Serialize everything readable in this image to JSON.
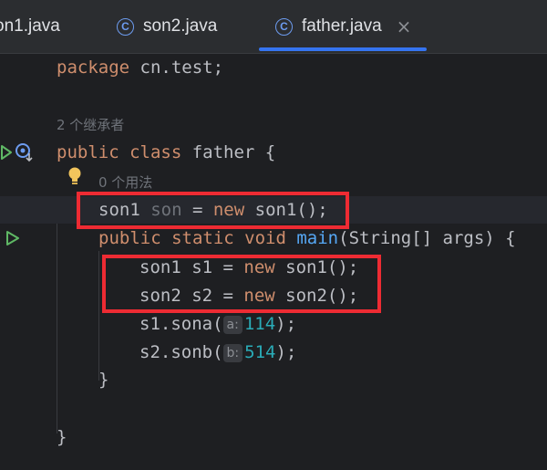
{
  "tabs": [
    {
      "label": "on1.java"
    },
    {
      "label": "son2.java",
      "icon": "class-icon"
    },
    {
      "label": "father.java",
      "icon": "class-icon",
      "active": true
    }
  ],
  "tab_class_glyph": "C",
  "tab_close_glyph": "×",
  "editor": {
    "hint_inheritors": "2 个继承者",
    "hint_usages": "0 个用法",
    "code": {
      "package_kw": "package",
      "package_name": " cn.test;",
      "public1": "public",
      "class_kw": " class",
      "class_name": " father {",
      "field_type": "son1",
      "field_name": " son",
      "field_eq": " = ",
      "field_new": "new",
      "field_ctor": " son1();",
      "public2": "public",
      "static_kw": " static",
      "void_kw": " void",
      "main_name": " main",
      "main_params": "(String[] args) {",
      "s1_type": "son1 s1 = ",
      "s1_new": "new",
      "s1_ctor": " son1();",
      "s2_type": "son2 s2 = ",
      "s2_new": "new",
      "s2_ctor": " son2();",
      "call1_pre": "s1.sona(",
      "call1_param": "a:",
      "call1_arg": "114",
      "call1_post": ");",
      "call2_pre": "s2.sonb(",
      "call2_param": "b:",
      "call2_arg": "514",
      "call2_post": ");",
      "close_method": "}",
      "close_class": "}"
    }
  },
  "colors": {
    "keyword": "#cf8e6d",
    "method": "#56a8f5",
    "number": "#2aacb8",
    "highlight_box": "#ee2b33"
  }
}
